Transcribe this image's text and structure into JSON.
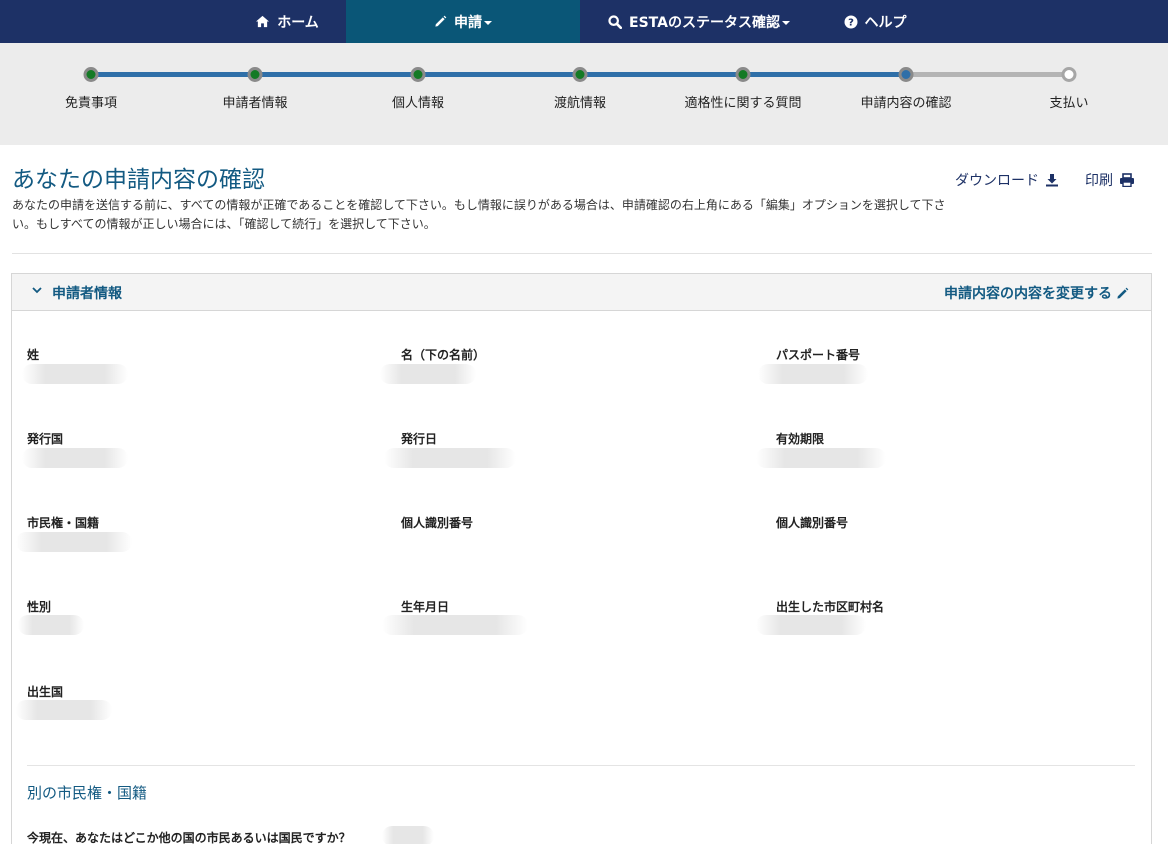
{
  "nav": {
    "items": [
      {
        "label": "ホーム",
        "icon": "home-icon"
      },
      {
        "label": "申請",
        "icon": "pencil-icon",
        "dropdown": true,
        "active": true
      },
      {
        "label": "ESTAのステータス確認",
        "icon": "search-icon",
        "dropdown": true
      },
      {
        "label": "ヘルプ",
        "icon": "question-circle-icon"
      }
    ]
  },
  "progress": {
    "steps": [
      {
        "label": "免責事項",
        "state": "done"
      },
      {
        "label": "申請者情報",
        "state": "done"
      },
      {
        "label": "個人情報",
        "state": "done"
      },
      {
        "label": "渡航情報",
        "state": "done"
      },
      {
        "label": "適格性に関する質問",
        "state": "done"
      },
      {
        "label": "申請内容の確認",
        "state": "current"
      },
      {
        "label": "支払い",
        "state": "todo"
      }
    ]
  },
  "page": {
    "title": "あなたの申請内容の確認",
    "description": "あなたの申請を送信する前に、すべての情報が正確であることを確認して下さい。もし情報に誤りがある場合は、申請確認の右上角にある「編集」オプションを選択して下さい。もしすべての情報が正しい場合には、「確認して続行」を選択して下さい。",
    "download_label": "ダウンロード",
    "print_label": "印刷"
  },
  "panel": {
    "title": "申請者情報",
    "edit_label": "申請内容の内容を変更する",
    "fields": [
      {
        "label": "姓"
      },
      {
        "label": "名（下の名前）"
      },
      {
        "label": "パスポート番号"
      },
      {
        "label": "発行国"
      },
      {
        "label": "発行日"
      },
      {
        "label": "有効期限"
      },
      {
        "label": "市民権・国籍"
      },
      {
        "label": "個人識別番号"
      },
      {
        "label": "個人識別番号"
      },
      {
        "label": "性別"
      },
      {
        "label": "生年月日"
      },
      {
        "label": "出生した市区町村名"
      },
      {
        "label": "出生国"
      }
    ],
    "other_citizenship": {
      "title": "別の市民権・国籍",
      "question": "今現在、あなたはどこか他の国の市民あるいは国民ですか？"
    }
  },
  "colors": {
    "nav_bg": "#1d3166",
    "nav_active": "#0a5677",
    "accent": "#135a82",
    "step_done": "#147a25",
    "step_current": "#2f6fa8"
  }
}
